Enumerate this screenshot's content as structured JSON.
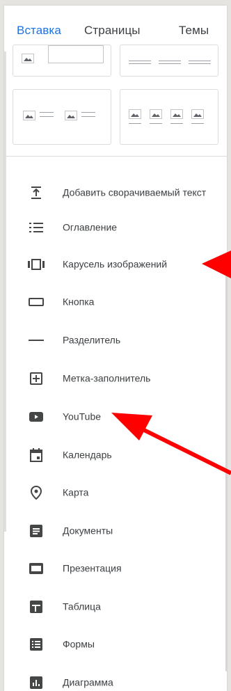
{
  "tabs": [
    {
      "label": "Вставка",
      "active": true
    },
    {
      "label": "Страницы",
      "active": false
    },
    {
      "label": "Темы",
      "active": false
    }
  ],
  "items": [
    {
      "icon": "collapsible-text-icon",
      "label": "Добавить сворачиваемый текст"
    },
    {
      "icon": "table-of-contents-icon",
      "label": "Оглавление"
    },
    {
      "icon": "image-carousel-icon",
      "label": "Карусель изображений"
    },
    {
      "icon": "button-icon",
      "label": "Кнопка"
    },
    {
      "icon": "divider-icon",
      "label": "Разделитель"
    },
    {
      "icon": "placeholder-icon",
      "label": "Метка-заполнитель"
    },
    {
      "icon": "youtube-icon",
      "label": "YouTube"
    },
    {
      "icon": "calendar-icon",
      "label": "Календарь"
    },
    {
      "icon": "map-pin-icon",
      "label": "Карта"
    },
    {
      "icon": "docs-icon",
      "label": "Документы"
    },
    {
      "icon": "slides-icon",
      "label": "Презентация"
    },
    {
      "icon": "sheets-icon",
      "label": "Таблица"
    },
    {
      "icon": "forms-icon",
      "label": "Формы"
    },
    {
      "icon": "chart-icon",
      "label": "Диаграмма"
    }
  ],
  "colors": {
    "accent": "#1a73e8",
    "icon": "#444746",
    "text": "#3c4043",
    "annotation_arrow": "#ff0000"
  }
}
